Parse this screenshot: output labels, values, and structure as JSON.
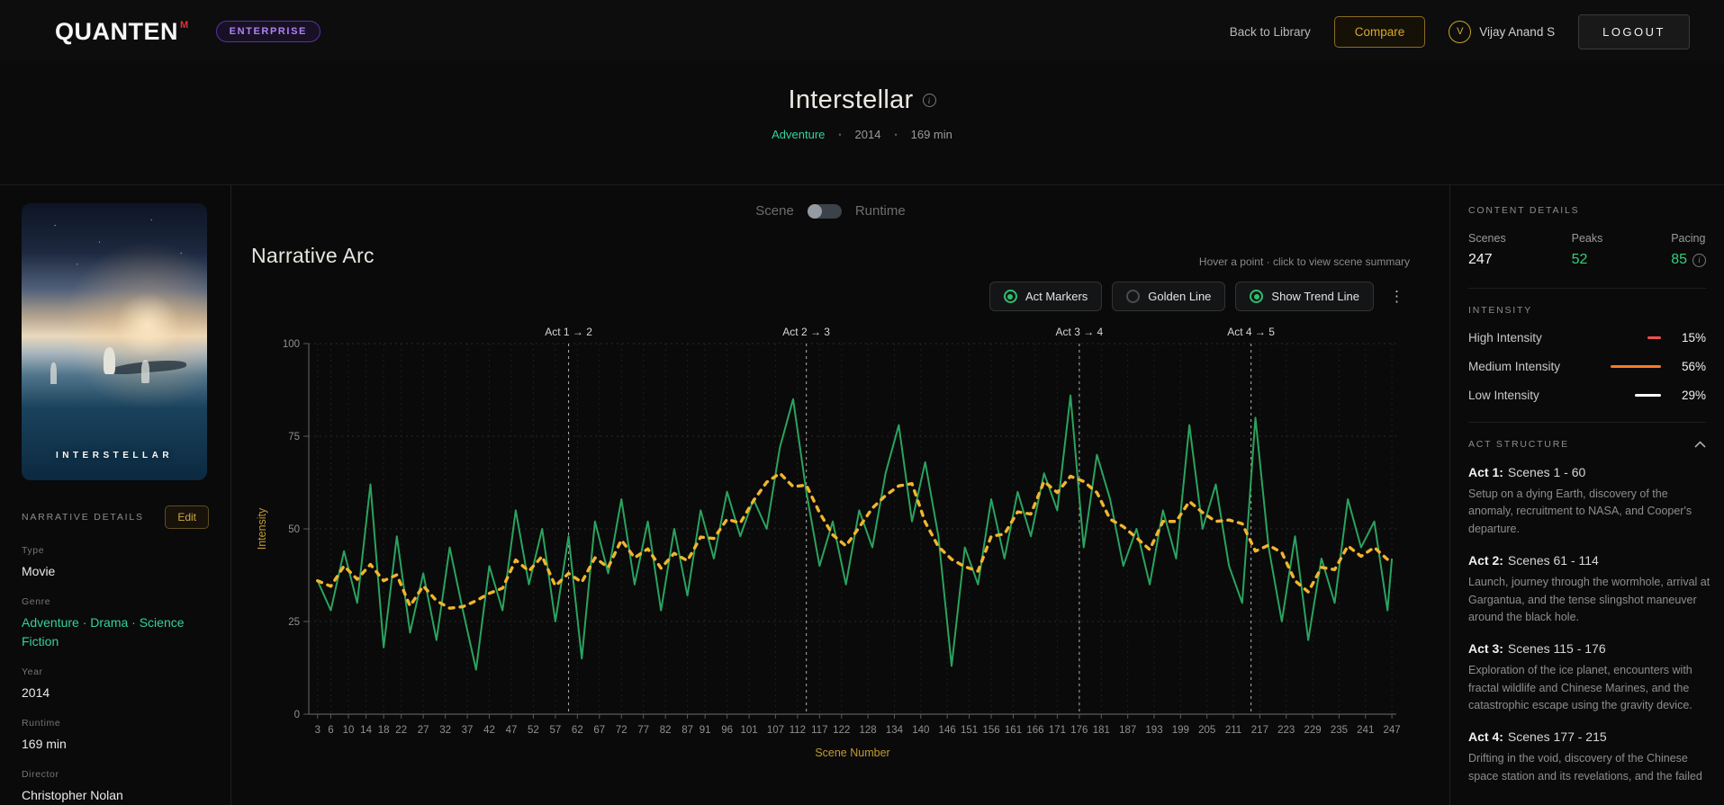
{
  "header": {
    "logo": "QUANTEN",
    "logo_sup": "M",
    "badge": "ENTERPRISE",
    "back_link": "Back to Library",
    "compare_label": "Compare",
    "avatar_initial": "V",
    "user_name": "Vijay Anand S",
    "logout_label": "LOGOUT"
  },
  "hero": {
    "title": "Interstellar",
    "genre": "Adventure",
    "dot": "•",
    "year": "2014",
    "runtime": "169 min"
  },
  "sidebar": {
    "poster_title": "INTERSTELLAR",
    "section_title": "NARRATIVE DETAILS",
    "edit_label": "Edit",
    "fields": [
      {
        "label": "Type",
        "value": "Movie"
      },
      {
        "label": "Genre",
        "value": "Adventure · Drama · Science Fiction"
      },
      {
        "label": "Year",
        "value": "2014"
      },
      {
        "label": "Runtime",
        "value": "169 min"
      },
      {
        "label": "Director",
        "value": "Christopher Nolan"
      }
    ]
  },
  "main": {
    "toggle": {
      "left": "Scene",
      "right": "Runtime",
      "state": "left"
    },
    "chart_title": "Narrative Arc",
    "hint": "Hover a point · click to view scene summary",
    "controls": [
      {
        "label": "Act Markers",
        "active": true
      },
      {
        "label": "Golden Line",
        "active": false
      },
      {
        "label": "Show Trend Line",
        "active": true
      }
    ],
    "kebab": "⋮"
  },
  "chart_data": {
    "type": "line",
    "title": "Narrative Arc",
    "xlabel": "Scene Number",
    "ylabel": "Intensity",
    "xlim": [
      1,
      248
    ],
    "ylim": [
      0,
      100
    ],
    "grid": true,
    "x_ticks": [
      3,
      6,
      10,
      14,
      18,
      22,
      27,
      32,
      37,
      42,
      47,
      52,
      57,
      62,
      67,
      72,
      77,
      82,
      87,
      91,
      96,
      101,
      107,
      112,
      117,
      122,
      128,
      134,
      140,
      146,
      151,
      156,
      161,
      166,
      171,
      176,
      181,
      187,
      193,
      199,
      205,
      211,
      217,
      223,
      229,
      235,
      241,
      247
    ],
    "y_ticks": [
      0,
      25,
      50,
      75,
      100
    ],
    "x": [
      3,
      6,
      9,
      12,
      15,
      18,
      21,
      24,
      27,
      30,
      33,
      36,
      39,
      42,
      45,
      48,
      51,
      54,
      57,
      60,
      63,
      66,
      69,
      72,
      75,
      78,
      81,
      84,
      87,
      90,
      93,
      96,
      99,
      102,
      105,
      108,
      111,
      114,
      117,
      120,
      123,
      126,
      129,
      132,
      135,
      138,
      141,
      144,
      147,
      150,
      153,
      156,
      159,
      162,
      165,
      168,
      171,
      174,
      177,
      180,
      183,
      186,
      189,
      192,
      195,
      198,
      201,
      204,
      207,
      210,
      213,
      216,
      219,
      222,
      225,
      228,
      231,
      234,
      237,
      240,
      243,
      246,
      247
    ],
    "values": [
      36,
      28,
      44,
      30,
      62,
      18,
      48,
      22,
      38,
      20,
      45,
      28,
      12,
      40,
      28,
      55,
      35,
      50,
      25,
      48,
      15,
      52,
      38,
      58,
      35,
      52,
      28,
      50,
      32,
      55,
      42,
      60,
      48,
      58,
      50,
      72,
      85,
      60,
      40,
      52,
      35,
      55,
      45,
      65,
      78,
      52,
      68,
      48,
      13,
      45,
      35,
      58,
      42,
      60,
      48,
      65,
      55,
      86,
      45,
      70,
      58,
      40,
      50,
      35,
      55,
      42,
      78,
      50,
      62,
      40,
      30,
      80,
      45,
      25,
      48,
      20,
      42,
      30,
      58,
      45,
      52,
      28,
      42
    ],
    "series": [
      {
        "name": "Scene Intensity",
        "color": "#2aa35f",
        "style": "solid"
      },
      {
        "name": "Trend Line",
        "color": "#f1b52e",
        "style": "dashed",
        "derived": "5-point moving average of Scene Intensity"
      }
    ],
    "act_markers": [
      {
        "scene": 60,
        "label": "Act 1 → 2"
      },
      {
        "scene": 114,
        "label": "Act 2 → 3"
      },
      {
        "scene": 176,
        "label": "Act 3 → 4"
      },
      {
        "scene": 215,
        "label": "Act 4 → 5"
      }
    ]
  },
  "details_panel": {
    "content_details": {
      "title": "CONTENT DETAILS",
      "stats": [
        {
          "label": "Scenes",
          "value": "247",
          "green": false,
          "info": false
        },
        {
          "label": "Peaks",
          "value": "52",
          "green": true,
          "info": false
        },
        {
          "label": "Pacing",
          "value": "85",
          "green": true,
          "info": true
        }
      ]
    },
    "intensity": {
      "title": "INTENSITY",
      "rows": [
        {
          "label": "High Intensity",
          "pct": "15%",
          "color": "#ef4f4f"
        },
        {
          "label": "Medium Intensity",
          "pct": "56%",
          "color": "#f97b22"
        },
        {
          "label": "Low Intensity",
          "pct": "29%",
          "color": "#ffffff"
        }
      ]
    },
    "act_structure": {
      "title": "ACT STRUCTURE",
      "acts": [
        {
          "name": "Act 1:",
          "range": "Scenes 1 - 60",
          "desc": "Setup on a dying Earth, discovery of the anomaly, recruitment to NASA, and Cooper's departure."
        },
        {
          "name": "Act 2:",
          "range": "Scenes 61 - 114",
          "desc": "Launch, journey through the wormhole, arrival at Gargantua, and the tense slingshot maneuver around the black hole."
        },
        {
          "name": "Act 3:",
          "range": "Scenes 115 - 176",
          "desc": "Exploration of the ice planet, encounters with fractal wildlife and Chinese Marines, and the catastrophic escape using the gravity device."
        },
        {
          "name": "Act 4:",
          "range": "Scenes 177 - 215",
          "desc": "Drifting in the void, discovery of the Chinese space station and its revelations, and the failed"
        }
      ]
    }
  }
}
